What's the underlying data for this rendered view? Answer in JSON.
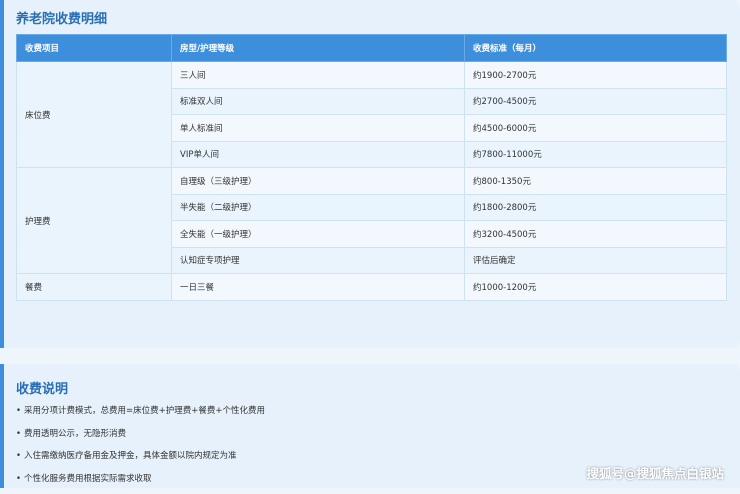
{
  "fee_section": {
    "title": "养老院收费明细",
    "headers": [
      "收费项目",
      "房型/护理等级",
      "收费标准（每月）"
    ],
    "rows": [
      {
        "category": "床位费",
        "span": 4,
        "item": "三人间",
        "price": "约1900-2700元"
      },
      {
        "item": "标准双人间",
        "price": "约2700-4500元"
      },
      {
        "item": "单人标准间",
        "price": "约4500-6000元"
      },
      {
        "item": "VIP单人间",
        "price": "约7800-11000元"
      },
      {
        "category": "护理费",
        "span": 4,
        "item": "自理级（三级护理）",
        "price": "约800-1350元"
      },
      {
        "item": "半失能（二级护理）",
        "price": "约1800-2800元"
      },
      {
        "item": "全失能（一级护理）",
        "price": "约3200-4500元"
      },
      {
        "item": "认知症专项护理",
        "price": "评估后确定"
      },
      {
        "category": "餐费",
        "span": 1,
        "item": "一日三餐",
        "price": "约1000-1200元"
      }
    ]
  },
  "notes_section": {
    "title": "收费说明",
    "items": [
      "采用分项计费模式，总费用=床位费+护理费+餐费+个性化费用",
      "费用透明公示，无隐形消费",
      "入住需缴纳医疗备用金及押金，具体金额以院内规定为准",
      "个性化服务费用根据实际需求收取"
    ]
  },
  "watermark": "搜狐号@搜狐焦点白银站"
}
